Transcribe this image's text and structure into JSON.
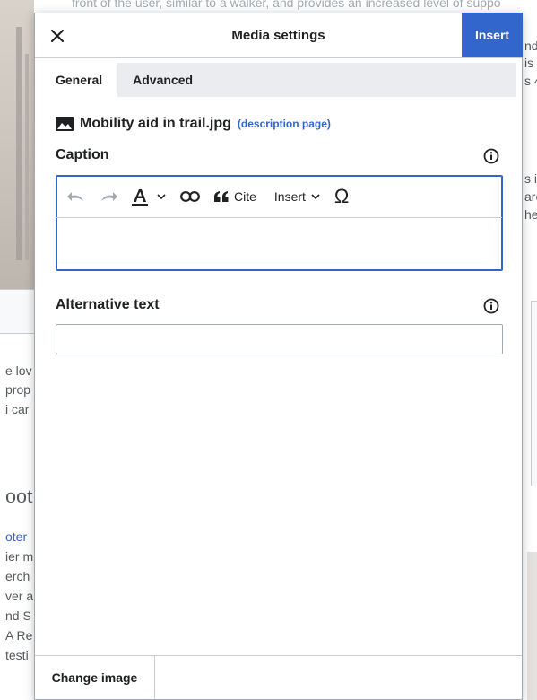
{
  "background": {
    "top_snippet": "front of the user, similar to a walker, and provides an increased level of suppo",
    "right_snippets": [
      "nds",
      "is",
      "s 4",
      "s i",
      "arc",
      "he"
    ],
    "left_snippets": [
      "e lov",
      "prop",
      "i car"
    ],
    "heading_fragment": "oot",
    "left_list": [
      "oter",
      "ier m",
      "erch",
      "ver a",
      "nd S",
      "A Re",
      "testi"
    ]
  },
  "dialog": {
    "title": "Media settings",
    "insert_label": "Insert",
    "tabs": [
      {
        "label": "General",
        "active": true
      },
      {
        "label": "Advanced",
        "active": false
      }
    ],
    "file_name": "Mobility aid in trail.jpg",
    "description_link": "(description page)",
    "caption": {
      "label": "Caption",
      "value": "",
      "toolbar": {
        "cite_label": "Cite",
        "insert_label": "Insert",
        "special_char": "Ω"
      }
    },
    "alt_text": {
      "label": "Alternative text",
      "value": ""
    },
    "change_image_label": "Change image"
  },
  "colors": {
    "accent": "#3366cc",
    "border": "#c8ccd1",
    "tab_bar": "#eaecf0",
    "text": "#202122",
    "disabled": "#a2a9b1"
  },
  "icons": [
    "close-icon",
    "image-icon",
    "info-icon",
    "undo-icon",
    "redo-icon",
    "text-style-icon",
    "chevron-down-icon",
    "link-icon",
    "quote-icon",
    "omega-icon"
  ]
}
